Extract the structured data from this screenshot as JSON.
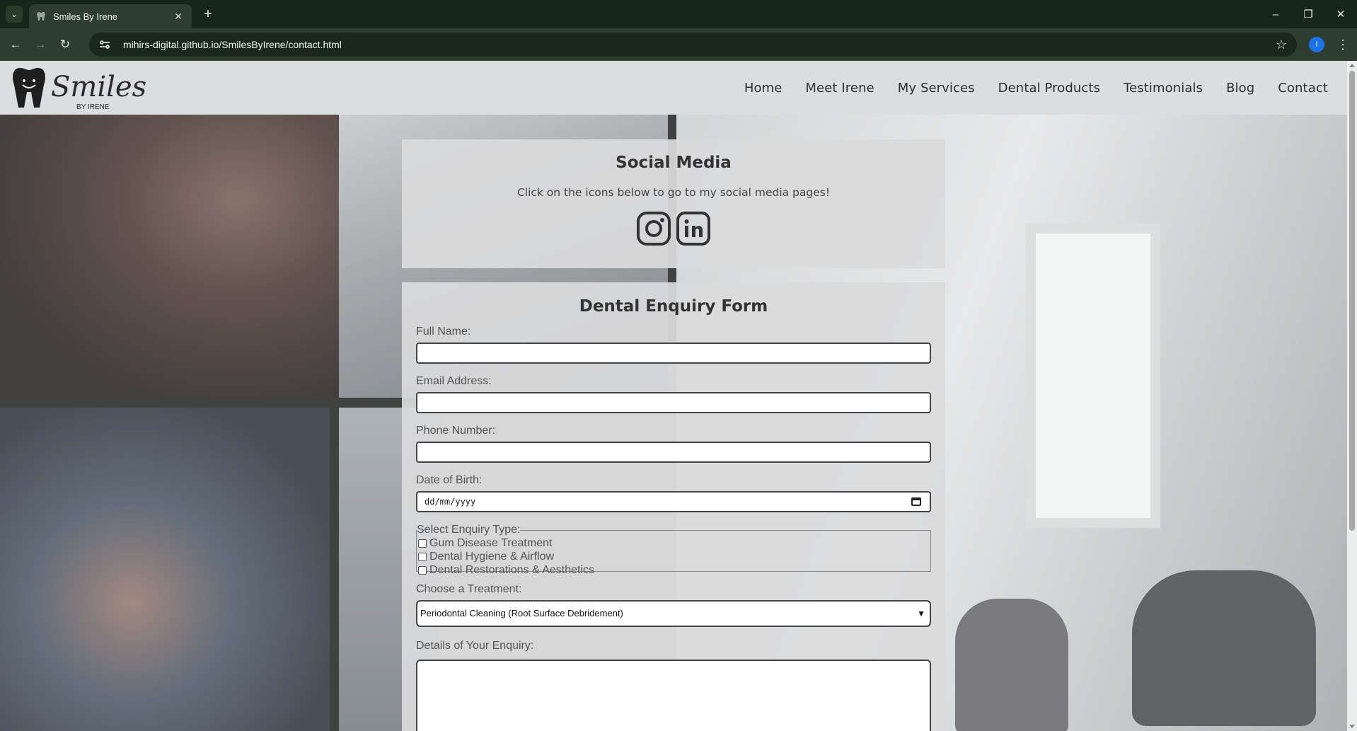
{
  "browser": {
    "tab_title": "Smiles By Irene",
    "url": "mihirs-digital.github.io/SmilesByIrene/contact.html",
    "profile_initial": "I",
    "accent_color": "#1a73e8"
  },
  "site": {
    "logo_text": "Smiles",
    "logo_subtext": "BY IRENE",
    "nav": [
      "Home",
      "Meet Irene",
      "My Services",
      "Dental Products",
      "Testimonials",
      "Blog",
      "Contact"
    ]
  },
  "social": {
    "heading": "Social Media",
    "subtext": "Click on the icons below to go to my social media pages!",
    "icons": [
      "instagram-icon",
      "linkedin-icon"
    ]
  },
  "form": {
    "heading": "Dental Enquiry Form",
    "full_name_label": "Full Name:",
    "email_label": "Email Address:",
    "phone_label": "Phone Number:",
    "dob_label": "Date of Birth:",
    "dob_placeholder": "dd/mm/yyyy",
    "enquiry_type_legend": "Select Enquiry Type:",
    "enquiry_types": [
      "Gum Disease Treatment",
      "Dental Hygiene & Airflow",
      "Dental Restorations & Aesthetics"
    ],
    "treatment_label": "Choose a Treatment:",
    "treatment_selected": "Periodontal Cleaning (Root Surface Debridement)",
    "details_label": "Details of Your Enquiry:"
  }
}
